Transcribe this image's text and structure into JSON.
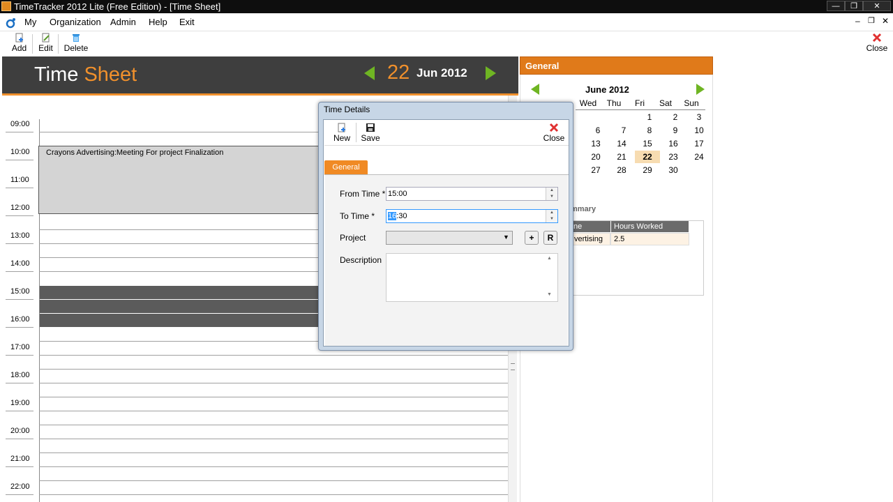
{
  "window": {
    "title": "TimeTracker 2012 Lite (Free Edition)  - [Time Sheet]",
    "controls": {
      "minimize": "—",
      "restore": "❐",
      "close": "✕"
    }
  },
  "menu": [
    "My",
    "Organization",
    "Admin",
    "Help",
    "Exit"
  ],
  "mdi_controls": {
    "minimize": "–",
    "restore": "❐",
    "close": "✕"
  },
  "toolbar": {
    "add": "Add",
    "edit": "Edit",
    "delete": "Delete",
    "close": "Close"
  },
  "timesheet": {
    "title_part1": "Time",
    "title_part2": "Sheet",
    "day": "22",
    "month_year": "Jun 2012",
    "hours": [
      "09:00",
      "10:00",
      "11:00",
      "12:00",
      "13:00",
      "14:00",
      "15:00",
      "16:00",
      "17:00",
      "18:00",
      "19:00",
      "20:00",
      "21:00",
      "22:00"
    ],
    "appointment": "Crayons Advertising:Meeting For project Finalization"
  },
  "general_panel": {
    "header": "General",
    "calendar": {
      "title": "June 2012",
      "days_of_week": [
        "Wed",
        "Thu",
        "Fri",
        "Sat",
        "Sun"
      ],
      "weeks": [
        [
          "",
          "",
          "1",
          "2",
          "3"
        ],
        [
          "6",
          "7",
          "8",
          "9",
          "10"
        ],
        [
          "13",
          "14",
          "15",
          "16",
          "17"
        ],
        [
          "20",
          "21",
          "22",
          "23",
          "24"
        ],
        [
          "27",
          "28",
          "29",
          "30",
          ""
        ]
      ],
      "selected": "22"
    },
    "summary": {
      "title": "mmary",
      "columns": [
        "ne",
        "Hours Worked"
      ],
      "rows": [
        [
          "vertising",
          "2.5"
        ]
      ]
    }
  },
  "dialog": {
    "title": "Time Details",
    "toolbar": {
      "new": "New",
      "save": "Save",
      "close": "Close"
    },
    "tab": "General",
    "from_time_label": "From Time *",
    "from_time_value": "15:00",
    "to_time_label": "To Time *",
    "to_time_selected": "16",
    "to_time_rest": ":30",
    "project_label": "Project",
    "project_value": "",
    "add_button": "+",
    "r_button": "R",
    "description_label": "Description",
    "description_value": ""
  },
  "colors": {
    "accent": "#f0902c",
    "header_dark": "#3e3e3e",
    "nav_arrow": "#6fb523",
    "busy_block": "#5b5b5b",
    "selection": "#3399ff"
  }
}
